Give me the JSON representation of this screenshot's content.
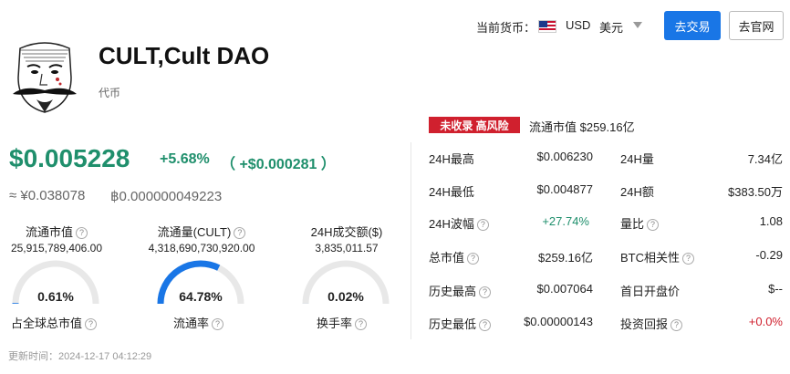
{
  "header": {
    "currency_label": "当前货币：",
    "currency_code": "USD",
    "currency_name": "美元",
    "trade_button": "去交易",
    "site_button": "去官网"
  },
  "coin": {
    "name": "CULT,Cult DAO",
    "type": "代币",
    "risk_badge": "未收录 高风险",
    "market_cap_top": "流通市值 $259.16亿",
    "price": "$0.005228",
    "change_pct": "+5.68%",
    "change_abs": "（ +$0.000281 ）",
    "price_cny": "≈ ¥0.038078",
    "price_btc": "฿0.000000049223"
  },
  "stats": [
    {
      "label": "流通市值",
      "value": "25,915,789,406.00"
    },
    {
      "label": "流通量(CULT)",
      "value": "4,318,690,730,920.00"
    },
    {
      "label": "24H成交额($)",
      "value": "3,835,011.57"
    }
  ],
  "gauges": [
    {
      "value": "0.61%",
      "fraction": 0.0061,
      "label": "占全球总市值"
    },
    {
      "value": "64.78%",
      "fraction": 0.6478,
      "label": "流通率"
    },
    {
      "value": "0.02%",
      "fraction": 0.0002,
      "label": "换手率"
    }
  ],
  "updated": "更新时间：2024-12-17 04:12:29",
  "table": [
    {
      "l1": "24H最高",
      "v1": "$0.006230",
      "l2": "24H量",
      "v2": "7.34亿"
    },
    {
      "l1": "24H最低",
      "v1": "$0.004877",
      "l2": "24H额",
      "v2": "$383.50万"
    },
    {
      "l1": "24H波幅",
      "v1": "+27.74%",
      "l2": "量比",
      "v2": "1.08"
    },
    {
      "l1": "总市值",
      "v1": "$259.16亿",
      "l2": "BTC相关性",
      "v2": "-0.29"
    },
    {
      "l1": "历史最高",
      "v1": "$0.007064",
      "l2": "首日开盘价",
      "v2": "$--"
    },
    {
      "l1": "历史最低",
      "v1": "$0.00000143",
      "l2": "投资回报",
      "v2": "+0.0%"
    }
  ],
  "colors": {
    "green": "#1f8f6c",
    "red": "#d0202e",
    "blue": "#1976e6"
  }
}
